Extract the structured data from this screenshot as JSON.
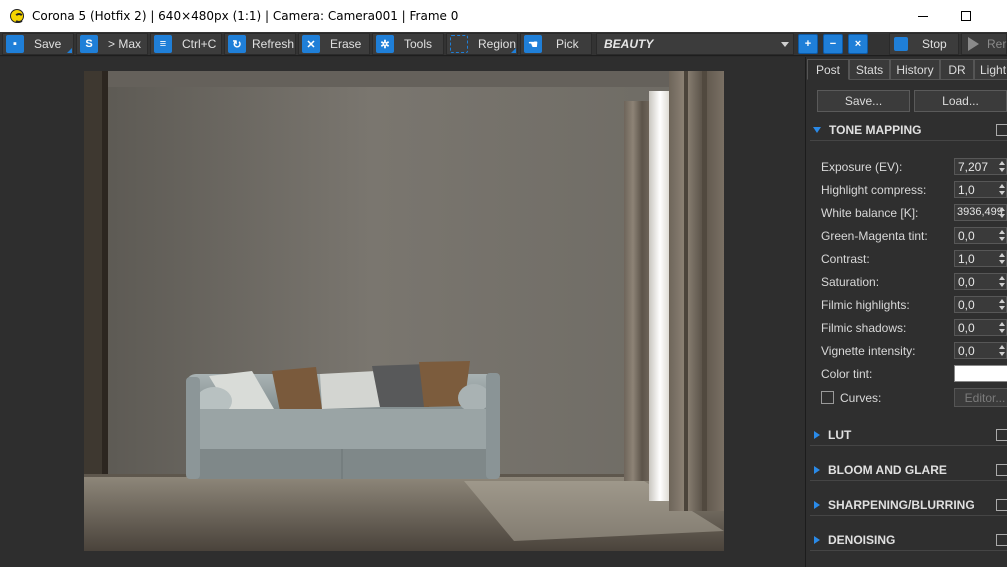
{
  "window": {
    "title": "Corona 5 (Hotfix 2) | 640×480px (1:1) | Camera: Camera001 | Frame 0"
  },
  "toolbar": {
    "save": "Save",
    "max": "> Max",
    "copy": "Ctrl+C",
    "refresh": "Refresh",
    "erase": "Erase",
    "tools": "Tools",
    "region": "Region",
    "pick": "Pick",
    "pass": "BEAUTY",
    "stop": "Stop",
    "render": "Rer"
  },
  "panel": {
    "tabs": [
      "Post",
      "Stats",
      "History",
      "DR",
      "Light"
    ],
    "save_button": "Save...",
    "load_button": "Load...",
    "sections": {
      "tone_mapping": "TONE MAPPING",
      "lut": "LUT",
      "bloom": "BLOOM AND GLARE",
      "sharpen": "SHARPENING/BLURRING",
      "denoise": "DENOISING"
    },
    "params": [
      {
        "label": "Exposure (EV):",
        "value": "7,207"
      },
      {
        "label": "Highlight compress:",
        "value": "1,0"
      },
      {
        "label": "White balance [K]:",
        "value": "3936,499"
      },
      {
        "label": "Green-Magenta tint:",
        "value": "0,0"
      },
      {
        "label": "Contrast:",
        "value": "1,0"
      },
      {
        "label": "Saturation:",
        "value": "0,0"
      },
      {
        "label": "Filmic highlights:",
        "value": "0,0"
      },
      {
        "label": "Filmic shadows:",
        "value": "0,0"
      },
      {
        "label": "Vignette intensity:",
        "value": "0,0"
      }
    ],
    "color_tint_label": "Color tint:",
    "color_tint_value": "#ffffff",
    "curves_label": "Curves:",
    "editor_button": "Editor..."
  },
  "colors": {
    "accent": "#1f7fd8",
    "panel_bg": "#2f2f2f",
    "toolbar_bg": "#333333"
  }
}
